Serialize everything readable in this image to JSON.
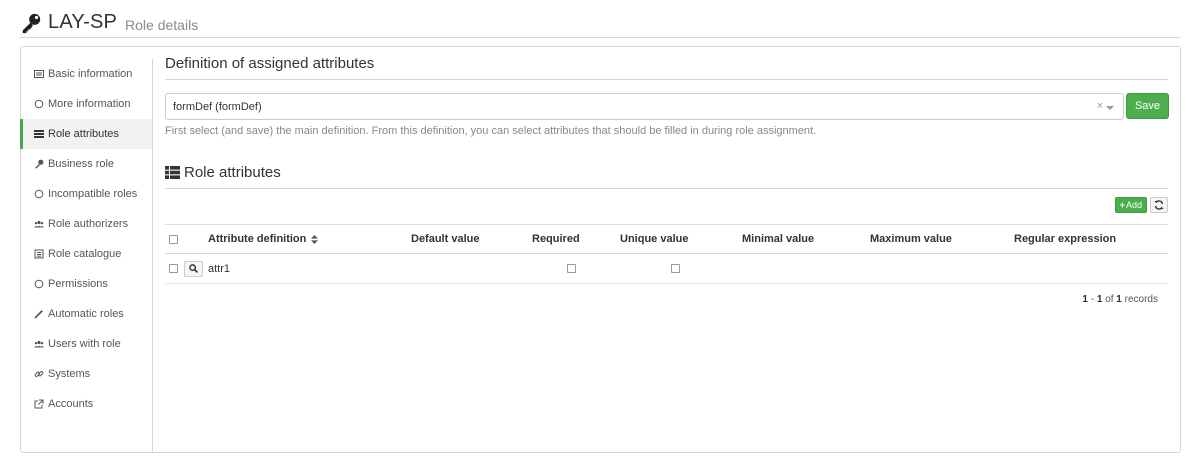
{
  "header": {
    "title": "LAY-SP",
    "subtitle": "Role details",
    "icon": "key-icon"
  },
  "sidebar": {
    "items": [
      {
        "label": "Basic information",
        "icon": "id-card-icon",
        "active": false
      },
      {
        "label": "More information",
        "icon": "circle-icon",
        "active": false
      },
      {
        "label": "Role attributes",
        "icon": "list-icon",
        "active": true
      },
      {
        "label": "Business role",
        "icon": "key-icon",
        "active": false
      },
      {
        "label": "Incompatible roles",
        "icon": "circle-icon",
        "active": false
      },
      {
        "label": "Role authorizers",
        "icon": "users-icon",
        "active": false
      },
      {
        "label": "Role catalogue",
        "icon": "catalogue-icon",
        "active": false
      },
      {
        "label": "Permissions",
        "icon": "circle-icon",
        "active": false
      },
      {
        "label": "Automatic roles",
        "icon": "wand-icon",
        "active": false
      },
      {
        "label": "Users with role",
        "icon": "users-icon",
        "active": false
      },
      {
        "label": "Systems",
        "icon": "link-icon",
        "active": false
      },
      {
        "label": "Accounts",
        "icon": "external-link-icon",
        "active": false
      }
    ]
  },
  "definition": {
    "title": "Definition of assigned attributes",
    "selected_value": "formDef (formDef)",
    "clear_glyph": "×",
    "save_label": "Save",
    "help": "First select (and save) the main definition. From this definition, you can select attributes that should be filled in during role assignment."
  },
  "attributes": {
    "title": "Role attributes",
    "add_label": "Add",
    "columns": [
      "Attribute definition",
      "Default value",
      "Required",
      "Unique value",
      "Minimal value",
      "Maximum value",
      "Regular expression"
    ],
    "rows": [
      {
        "attribute": "attr1",
        "default": "",
        "required": false,
        "unique": false,
        "min": "",
        "max": "",
        "regex": ""
      }
    ],
    "pager": {
      "from": "1",
      "to": "1",
      "of_label": "of",
      "total": "1",
      "records_label": "records",
      "sep": " - "
    }
  },
  "colors": {
    "accent": "#4cae4c",
    "active_border": "#4aa44a",
    "divider": "#c5e1c5"
  }
}
